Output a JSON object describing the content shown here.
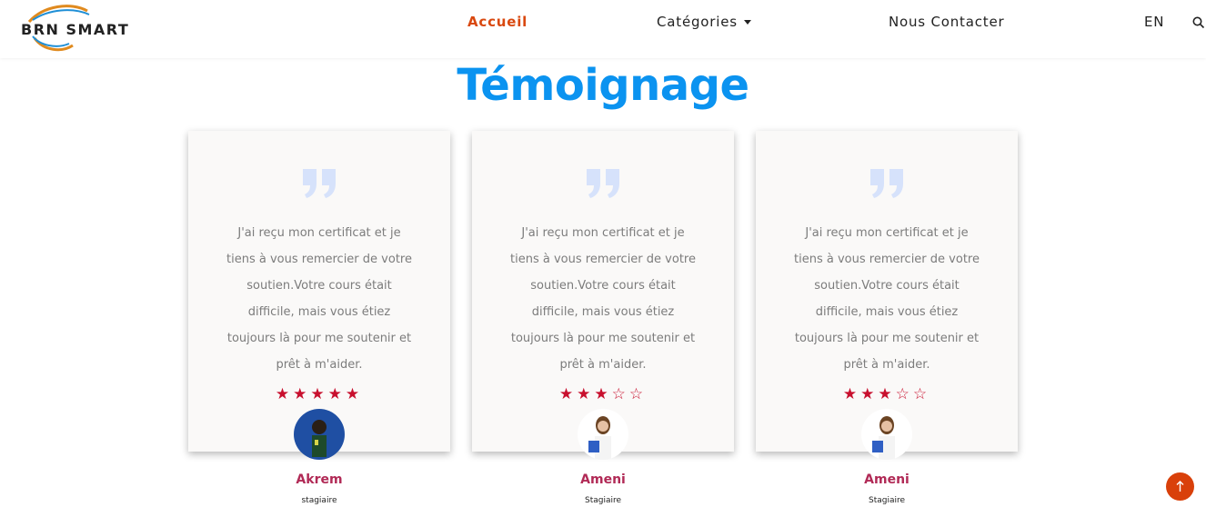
{
  "header": {
    "logo_text": "BRN SMART",
    "nav": {
      "home": "Accueil",
      "categories": "Catégories",
      "contact": "Nous Contacter",
      "language": "EN"
    }
  },
  "section": {
    "title": "Témoignage"
  },
  "testimonials": [
    {
      "text": "J'ai reçu mon certificat et je tiens à vous remercier de votre soutien.Votre cours était difficile, mais vous étiez toujours là pour me soutenir et prêt à m'aider.",
      "rating": 5,
      "name": "Akrem",
      "role": "stagiaire"
    },
    {
      "text": "J'ai reçu mon certificat et je tiens à vous remercier de votre soutien.Votre cours était difficile, mais vous étiez toujours là pour me soutenir et prêt à m'aider.",
      "rating": 3,
      "name": "Ameni",
      "role": "Stagiaire"
    },
    {
      "text": "J'ai reçu mon certificat et je tiens à vous remercier de votre soutien.Votre cours était difficile, mais vous étiez toujours là pour me soutenir et prêt à m'aider.",
      "rating": 3,
      "name": "Ameni",
      "role": "Stagiaire"
    }
  ],
  "colors": {
    "accent": "#d9480f",
    "title": "#0b93f0",
    "star": "#c8102e",
    "name": "#b12a56"
  }
}
